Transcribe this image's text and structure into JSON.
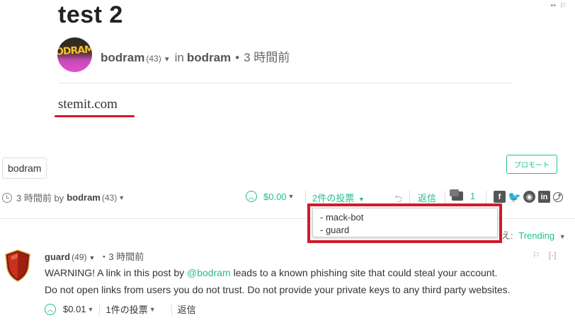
{
  "post": {
    "title": "test 2",
    "author": {
      "name": "bodram",
      "rep": "(43)"
    },
    "in_label": "in",
    "category": "bodram",
    "separator": "•",
    "time": "3 時間前",
    "avatar_text": "ODRAM",
    "body_link": "stemit.com",
    "tag": "bodram",
    "promote_label": "プロモート",
    "footer": {
      "time_by": "3 時間前 by",
      "author": "bodram",
      "rep": "(43)",
      "payout": "$0.00",
      "votes_label": "2件の投票",
      "reply_label": "返信",
      "comment_count": "1"
    },
    "voters_popup": [
      "- mack-bot",
      "- guard"
    ]
  },
  "sort": {
    "label": "え:",
    "value": "Trending"
  },
  "comment": {
    "author": "guard",
    "rep": "(49)",
    "time": "・3 時間前",
    "line1_before": "WARNING! A link in this post by ",
    "line1_mention": "@bodram",
    "line1_after": " leads to a known phishing site that could steal your account.",
    "line2": "Do not open links from users you do not trust. Do not provide your private keys to any third party websites.",
    "payout": "$0.01",
    "votes_label": "1件の投票",
    "reply_label": "返信",
    "collapse_label": "[-]"
  },
  "icons": {
    "clock": "clock-icon",
    "upvote": "upvote-icon",
    "reblog": "reblog-icon",
    "comments": "comments-icon",
    "facebook": "facebook-icon",
    "twitter": "twitter-icon",
    "reddit": "reddit-icon",
    "linkedin": "linkedin-icon",
    "flag": "flag-icon"
  },
  "colors": {
    "accent": "#1fbf8f",
    "highlight": "#d11a2a"
  }
}
